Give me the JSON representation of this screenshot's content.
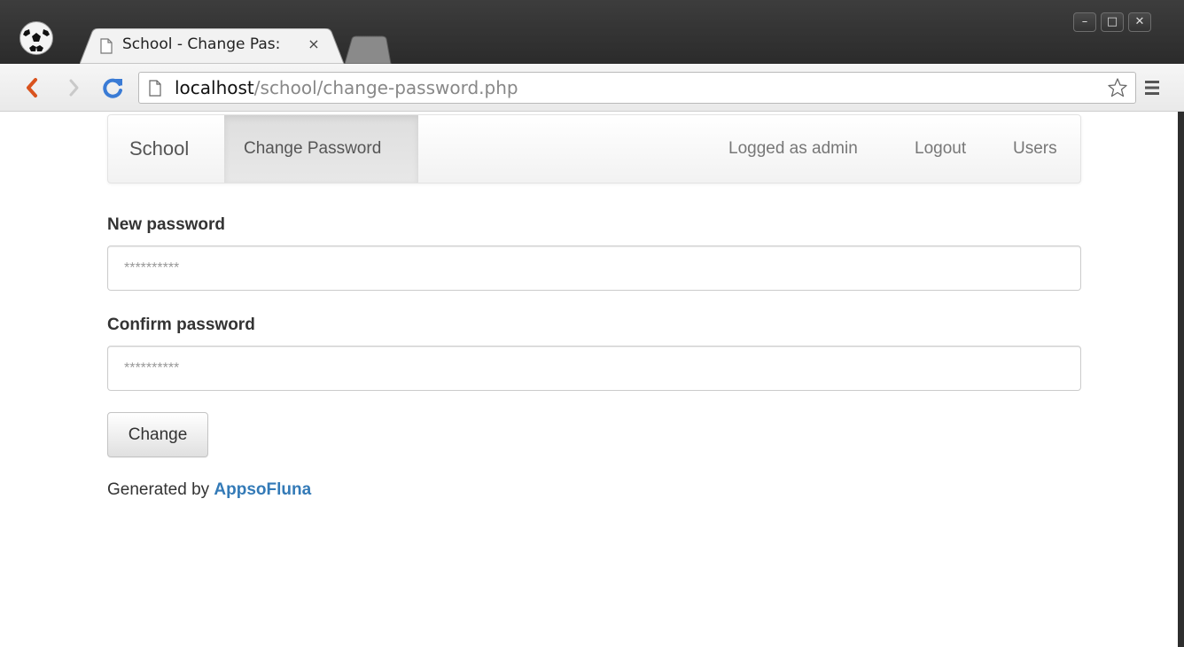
{
  "browser": {
    "tab_title": "School - Change Pas:",
    "tab_close": "×",
    "url_host": "localhost",
    "url_path": "/school/change-password.php",
    "window_buttons": {
      "minimize": "–",
      "maximize": "□",
      "close": "✕"
    }
  },
  "navbar": {
    "brand": "School",
    "active_item": "Change Password",
    "right_items": [
      "Logged as admin",
      "Logout",
      "Users"
    ]
  },
  "form": {
    "new_password_label": "New password",
    "new_password_placeholder": "**********",
    "confirm_password_label": "Confirm password",
    "confirm_password_placeholder": "**********",
    "submit_label": "Change"
  },
  "footer": {
    "prefix": "Generated by ",
    "link_text": "AppsoFluna"
  },
  "colors": {
    "link": "#337ab7",
    "reload_icon": "#3a7bd5",
    "back_icon": "#d9531e"
  },
  "icons": [
    "app-logo-soccer-ball",
    "document-icon",
    "back-arrow-icon",
    "forward-arrow-icon",
    "reload-icon",
    "star-icon",
    "menu-icon"
  ]
}
